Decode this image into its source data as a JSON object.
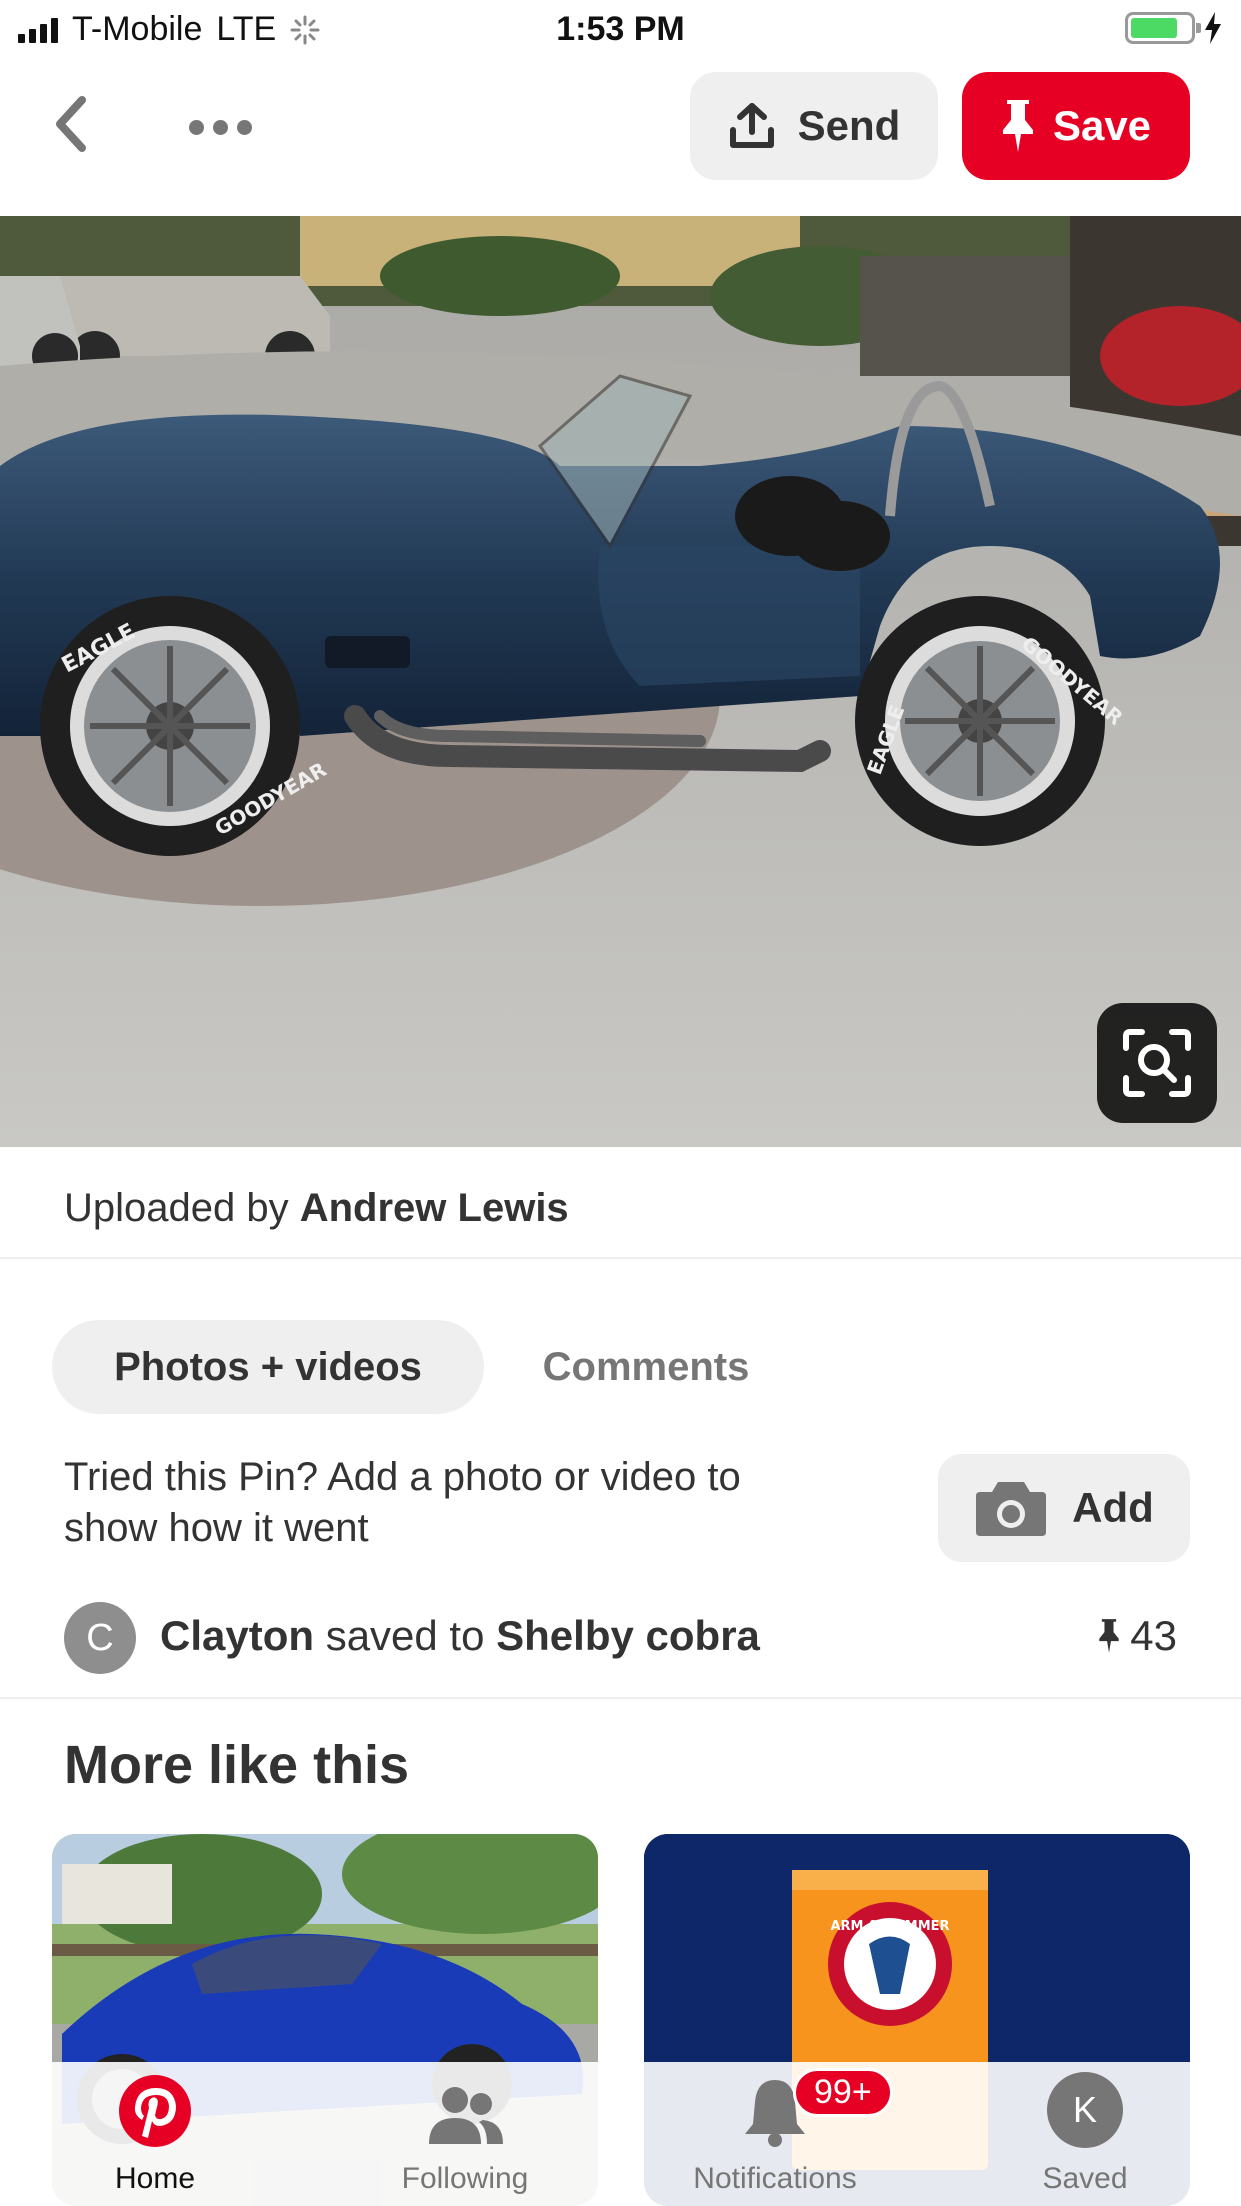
{
  "status_bar": {
    "carrier": "T-Mobile",
    "network": "LTE",
    "time": "1:53 PM",
    "battery_level": 0.8
  },
  "header": {
    "send_label": "Send",
    "save_label": "Save"
  },
  "pin": {
    "uploaded_prefix": "Uploaded by",
    "uploader": "Andrew Lewis",
    "tire_brand_1": "EAGLE",
    "tire_brand_2": "GOODYEAR"
  },
  "tabs": {
    "active_label": "Photos + videos",
    "inactive_label": "Comments"
  },
  "tried": {
    "line1": "Tried this Pin? Add a photo or video to",
    "line2": "show how it went",
    "add_label": "Add"
  },
  "saved": {
    "avatar_initial": "C",
    "user": "Clayton",
    "middle": "saved to",
    "board": "Shelby cobra",
    "count": "43"
  },
  "more_like_this": {
    "title": "More like this",
    "card2_logo_text": "ARM & HAMMER"
  },
  "nav": {
    "home": "Home",
    "following": "Following",
    "notifications": "Notifications",
    "notif_badge": "99+",
    "saved": "Saved",
    "saved_avatar": "K"
  },
  "colors": {
    "brand_red": "#e60023",
    "button_gray": "#efefef",
    "text_dark": "#333333",
    "text_muted": "#767676"
  }
}
